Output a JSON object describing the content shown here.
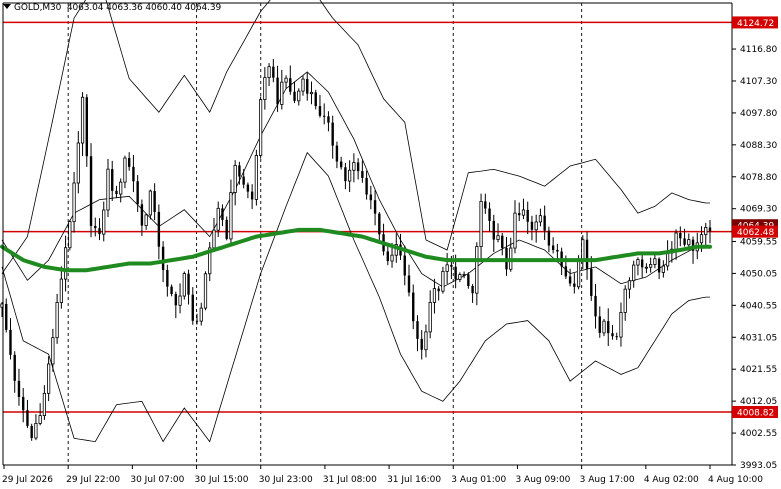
{
  "title": {
    "symbol": "GOLD,M30",
    "ohlc": "4063.04 4063.36 4060.40 4064.39"
  },
  "colors": {
    "background": "#ffffff",
    "candle": "#000000",
    "bands": "#000000",
    "ma": "#1f8a1f",
    "level": "#d40000",
    "level_label_bg": "#d40000",
    "level_label_text": "#ffffff",
    "current_label_bg": "#7a0000"
  },
  "chart_data": {
    "type": "candlestick",
    "symbol": "GOLD",
    "timeframe": "M30",
    "y_range": [
      3993.05,
      4130.5
    ],
    "y_ticks": [
      "4116.80",
      "4107.30",
      "4097.80",
      "4088.30",
      "4078.80",
      "4069.30",
      "4059.55",
      "4050.05",
      "4040.55",
      "4031.05",
      "4021.55",
      "4012.05",
      "4002.55",
      "3993.05"
    ],
    "x_labels": [
      "29 Jul 2026",
      "29 Jul 22:00",
      "30 Jul 07:00",
      "30 Jul 15:00",
      "30 Jul 23:00",
      "31 Jul 08:00",
      "31 Jul 16:00",
      "3 Aug 01:00",
      "3 Aug 09:00",
      "3 Aug 17:00",
      "4 Aug 02:00",
      "4 Aug 10:00"
    ],
    "session_separators": [
      "29 Jul 22:00",
      "30 Jul 15:00",
      "30 Jul 23:00",
      "3 Aug 01:00",
      "3 Aug 17:00"
    ],
    "horizontal_levels": [
      {
        "value": 4124.72,
        "label": "4124.72"
      },
      {
        "value": 4062.48,
        "label": "4062.48"
      },
      {
        "value": 4008.82,
        "label": "4008.82"
      }
    ],
    "current_price": {
      "value": 4064.39,
      "label": "4064.39"
    },
    "close_path": [
      [
        0,
        4040
      ],
      [
        4,
        4012
      ],
      [
        7,
        4001
      ],
      [
        10,
        4014
      ],
      [
        13,
        4040
      ],
      [
        15,
        4058
      ],
      [
        17,
        4075
      ],
      [
        19,
        4101
      ],
      [
        21,
        4066
      ],
      [
        23,
        4060
      ],
      [
        25,
        4080
      ],
      [
        27,
        4072
      ],
      [
        29,
        4085
      ],
      [
        31,
        4078
      ],
      [
        33,
        4064
      ],
      [
        35,
        4074
      ],
      [
        37,
        4059
      ],
      [
        39,
        4045
      ],
      [
        41,
        4040
      ],
      [
        43,
        4050
      ],
      [
        45,
        4035
      ],
      [
        47,
        4040
      ],
      [
        49,
        4056
      ],
      [
        51,
        4070
      ],
      [
        53,
        4062
      ],
      [
        55,
        4083
      ],
      [
        57,
        4076
      ],
      [
        59,
        4072
      ],
      [
        61,
        4100
      ],
      [
        63,
        4113
      ],
      [
        65,
        4102
      ],
      [
        67,
        4108
      ],
      [
        69,
        4101
      ],
      [
        71,
        4108
      ],
      [
        73,
        4103
      ],
      [
        75,
        4098
      ],
      [
        77,
        4093
      ],
      [
        79,
        4085
      ],
      [
        81,
        4078
      ],
      [
        83,
        4082
      ],
      [
        85,
        4078
      ],
      [
        87,
        4072
      ],
      [
        89,
        4063
      ],
      [
        91,
        4052
      ],
      [
        93,
        4058
      ],
      [
        95,
        4050
      ],
      [
        97,
        4036
      ],
      [
        99,
        4027
      ],
      [
        101,
        4042
      ],
      [
        103,
        4046
      ],
      [
        105,
        4052
      ],
      [
        107,
        4050
      ],
      [
        109,
        4048
      ],
      [
        111,
        4044
      ],
      [
        113,
        4071
      ],
      [
        115,
        4064
      ],
      [
        117,
        4060
      ],
      [
        119,
        4052
      ],
      [
        121,
        4066
      ],
      [
        123,
        4068
      ],
      [
        125,
        4062
      ],
      [
        127,
        4068
      ],
      [
        129,
        4060
      ],
      [
        131,
        4055
      ],
      [
        133,
        4050
      ],
      [
        135,
        4048
      ],
      [
        137,
        4060
      ],
      [
        139,
        4044
      ],
      [
        141,
        4034
      ],
      [
        143,
        4034
      ],
      [
        145,
        4031
      ],
      [
        147,
        4046
      ],
      [
        149,
        4053
      ],
      [
        151,
        4052
      ],
      [
        153,
        4054
      ],
      [
        155,
        4051
      ],
      [
        157,
        4056
      ],
      [
        159,
        4062
      ],
      [
        161,
        4060
      ],
      [
        163,
        4058
      ],
      [
        165,
        4060
      ],
      [
        167,
        4064
      ]
    ],
    "bollinger": {
      "upper": [
        [
          0,
          4050
        ],
        [
          6,
          4061
        ],
        [
          11,
          4090
        ],
        [
          17,
          4126
        ],
        [
          23,
          4138
        ],
        [
          30,
          4108
        ],
        [
          37,
          4098
        ],
        [
          43,
          4109
        ],
        [
          49,
          4098
        ],
        [
          53,
          4110
        ],
        [
          61,
          4128
        ],
        [
          69,
          4140
        ],
        [
          73,
          4135
        ],
        [
          78,
          4126
        ],
        [
          84,
          4118
        ],
        [
          90,
          4102
        ],
        [
          95,
          4095
        ],
        [
          100,
          4060
        ],
        [
          105,
          4057
        ],
        [
          110,
          4080
        ],
        [
          116,
          4081
        ],
        [
          122,
          4079
        ],
        [
          128,
          4076
        ],
        [
          134,
          4082
        ],
        [
          140,
          4084
        ],
        [
          146,
          4075
        ],
        [
          150,
          4068
        ],
        [
          154,
          4070
        ],
        [
          158,
          4074
        ],
        [
          162,
          4072
        ],
        [
          166,
          4071
        ]
      ],
      "lower": [
        [
          0,
          4052
        ],
        [
          5,
          4030
        ],
        [
          11,
          4026
        ],
        [
          17,
          4001
        ],
        [
          22,
          4000
        ],
        [
          27,
          4011
        ],
        [
          33,
          4012
        ],
        [
          38,
          4000
        ],
        [
          43,
          4010
        ],
        [
          49,
          4000
        ],
        [
          55,
          4025
        ],
        [
          61,
          4050
        ],
        [
          67,
          4070
        ],
        [
          72,
          4086
        ],
        [
          77,
          4079
        ],
        [
          83,
          4060
        ],
        [
          89,
          4043
        ],
        [
          94,
          4026
        ],
        [
          99,
          4015
        ],
        [
          104,
          4012
        ],
        [
          108,
          4018
        ],
        [
          114,
          4030
        ],
        [
          119,
          4035
        ],
        [
          124,
          4036
        ],
        [
          129,
          4030
        ],
        [
          134,
          4018
        ],
        [
          140,
          4024
        ],
        [
          146,
          4020
        ],
        [
          150,
          4022
        ],
        [
          154,
          4030
        ],
        [
          158,
          4038
        ],
        [
          162,
          4042
        ],
        [
          166,
          4043
        ]
      ],
      "middle": [
        [
          0,
          4060
        ],
        [
          6,
          4048
        ],
        [
          11,
          4054
        ],
        [
          17,
          4068
        ],
        [
          23,
          4072
        ],
        [
          30,
          4073
        ],
        [
          37,
          4064
        ],
        [
          43,
          4069
        ],
        [
          49,
          4061
        ],
        [
          55,
          4075
        ],
        [
          61,
          4091
        ],
        [
          67,
          4105
        ],
        [
          72,
          4110
        ],
        [
          77,
          4104
        ],
        [
          83,
          4090
        ],
        [
          89,
          4072
        ],
        [
          94,
          4060
        ],
        [
          99,
          4050
        ],
        [
          104,
          4046
        ],
        [
          110,
          4050
        ],
        [
          116,
          4056
        ],
        [
          122,
          4060
        ],
        [
          128,
          4057
        ],
        [
          134,
          4050
        ],
        [
          140,
          4052
        ],
        [
          146,
          4047
        ],
        [
          152,
          4049
        ],
        [
          158,
          4054
        ],
        [
          164,
          4058
        ],
        [
          166,
          4058
        ]
      ]
    },
    "moving_average": [
      [
        0,
        4058
      ],
      [
        5,
        4054
      ],
      [
        10,
        4052
      ],
      [
        15,
        4051
      ],
      [
        20,
        4051
      ],
      [
        25,
        4052
      ],
      [
        30,
        4053
      ],
      [
        35,
        4053
      ],
      [
        40,
        4054
      ],
      [
        45,
        4055
      ],
      [
        50,
        4057
      ],
      [
        55,
        4059
      ],
      [
        60,
        4061
      ],
      [
        65,
        4062
      ],
      [
        70,
        4063
      ],
      [
        75,
        4063
      ],
      [
        80,
        4062
      ],
      [
        85,
        4061
      ],
      [
        90,
        4059
      ],
      [
        95,
        4057
      ],
      [
        100,
        4055
      ],
      [
        105,
        4054
      ],
      [
        110,
        4054
      ],
      [
        115,
        4054
      ],
      [
        120,
        4054
      ],
      [
        125,
        4054
      ],
      [
        130,
        4054
      ],
      [
        135,
        4054
      ],
      [
        140,
        4054
      ],
      [
        145,
        4055
      ],
      [
        150,
        4056
      ],
      [
        155,
        4056
      ],
      [
        160,
        4057
      ],
      [
        164,
        4058
      ],
      [
        166,
        4058
      ]
    ]
  }
}
